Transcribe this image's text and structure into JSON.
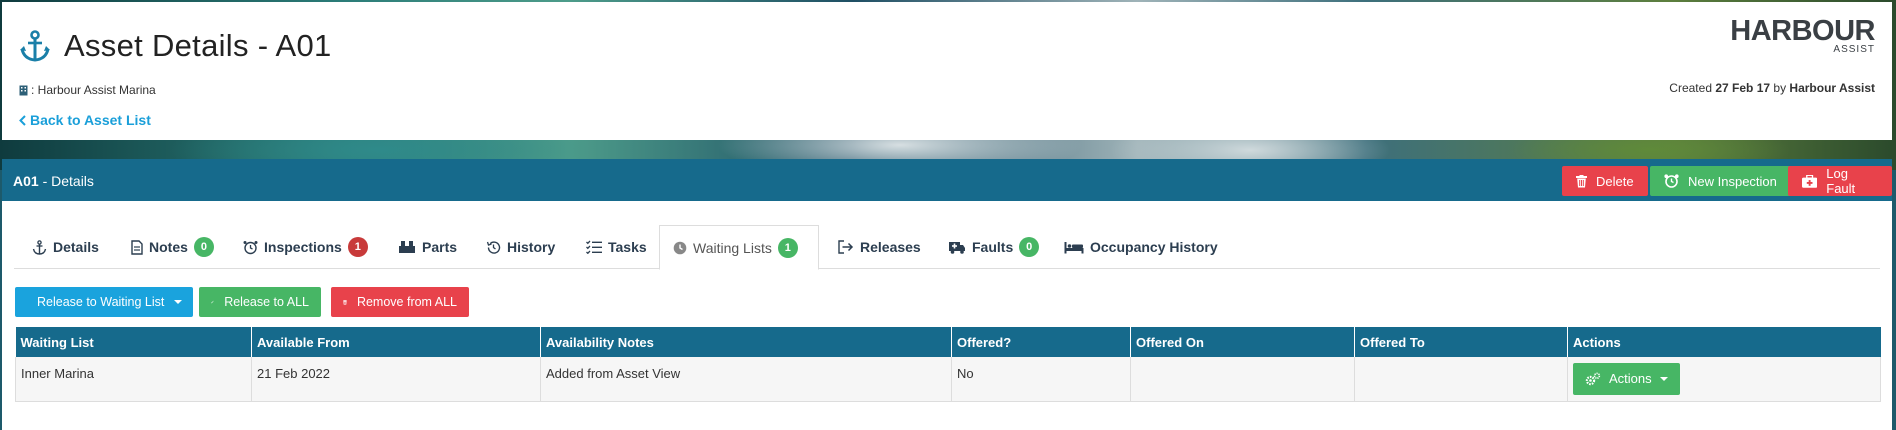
{
  "header": {
    "title": "Asset Details - A01",
    "marina": ": Harbour Assist Marina",
    "back_link": "Back to Asset List",
    "logo_text": "HARBOUR",
    "logo_sub": "ASSIST",
    "created_prefix": "Created",
    "created_date": "27 Feb 17",
    "created_by_prefix": "by",
    "created_by": "Harbour Assist"
  },
  "title_bar": {
    "asset_code": "A01",
    "suffix": " - Details",
    "buttons": {
      "delete": "Delete",
      "new_inspection": "New Inspection",
      "log_fault": "Log Fault"
    }
  },
  "tabs": [
    {
      "label": "Details",
      "icon": "anchor-icon",
      "badge": ""
    },
    {
      "label": "Notes",
      "icon": "note-icon",
      "badge": "0",
      "badge_color": "#47b665"
    },
    {
      "label": "Inspections",
      "icon": "alarm-clock-icon",
      "badge": "1",
      "badge_color": "#c83a3a"
    },
    {
      "label": "Parts",
      "icon": "parts-icon",
      "badge": ""
    },
    {
      "label": "History",
      "icon": "history-icon",
      "badge": ""
    },
    {
      "label": "Tasks",
      "icon": "list-check-icon",
      "badge": ""
    },
    {
      "label": "Waiting Lists",
      "icon": "clock-icon",
      "badge": "1",
      "badge_color": "#47b665",
      "active": true
    },
    {
      "label": "Releases",
      "icon": "release-arrow-icon",
      "badge": ""
    },
    {
      "label": "Faults",
      "icon": "ambulance-icon",
      "badge": "0",
      "badge_color": "#47b665"
    },
    {
      "label": "Occupancy History",
      "icon": "bed-icon",
      "badge": ""
    }
  ],
  "actions": {
    "release_to_waiting_list": "Release to Waiting List",
    "release_to_all": "Release to ALL",
    "remove_from_all": "Remove from ALL"
  },
  "table": {
    "columns": [
      "Waiting List",
      "Available From",
      "Availability Notes",
      "Offered?",
      "Offered On",
      "Offered To",
      "Actions"
    ],
    "rows": [
      {
        "waiting_list": "Inner Marina",
        "available_from": "21 Feb 2022",
        "notes": "Added from Asset View",
        "offered": "No",
        "offered_on": "",
        "offered_to": "",
        "action_label": "Actions"
      }
    ]
  },
  "colors": {
    "primary": "#166a8c",
    "danger": "#e8424b",
    "success": "#47b665",
    "info": "#1aa3dd",
    "link": "#1a9fd9"
  }
}
